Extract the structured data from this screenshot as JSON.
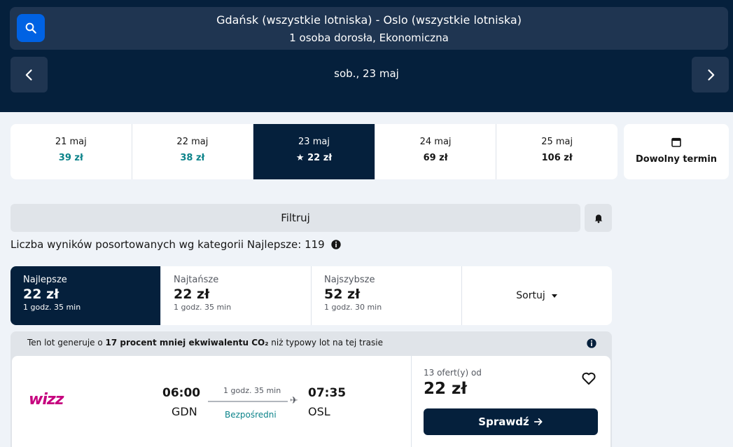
{
  "search": {
    "route": "Gdańsk (wszystkie lotniska) - Oslo (wszystkie lotniska)",
    "passengers": "1 osoba dorosła, Ekonomiczna",
    "date": "sob., 23 maj"
  },
  "dates": [
    {
      "date": "21 maj",
      "price": "39 zł",
      "cheap": true
    },
    {
      "date": "22 maj",
      "price": "38 zł",
      "cheap": true
    },
    {
      "date": "23 maj",
      "price": "★ 22 zł",
      "active": true
    },
    {
      "date": "24 maj",
      "price": "69 zł"
    },
    {
      "date": "25 maj",
      "price": "106 zł"
    }
  ],
  "any_date_label": "Dowolny termin",
  "filter_label": "Filtruj",
  "results_count": "Liczba wyników posortowanych wg kategorii Najlepsze: 119",
  "sort_tabs": [
    {
      "title": "Najlepsze",
      "price": "22 zł",
      "duration": "1 godz. 35 min"
    },
    {
      "title": "Najtańsze",
      "price": "22 zł",
      "duration": "1 godz. 35 min"
    },
    {
      "title": "Najszybsze",
      "price": "52 zł",
      "duration": "1 godz. 30 min"
    }
  ],
  "sort_label": "Sortuj",
  "eco": {
    "prefix": "Ten lot generuje o ",
    "bold": "17 procent mniej ekwiwalentu CO₂",
    "suffix": " niż typowy lot na tej trasie"
  },
  "flight": {
    "airline": "wizz",
    "dep_time": "06:00",
    "dep_code": "GDN",
    "arr_time": "07:35",
    "arr_code": "OSL",
    "duration": "1 godz. 35 min",
    "stops": "Bezpośredni",
    "offers": "13 ofert(y) od",
    "price": "22 zł",
    "select_label": "Sprawdź"
  },
  "colors": {
    "header_bg": "#05203c",
    "accent_blue": "#0062e3",
    "teal": "#0c838a",
    "airline_magenta": "#c6007e"
  }
}
